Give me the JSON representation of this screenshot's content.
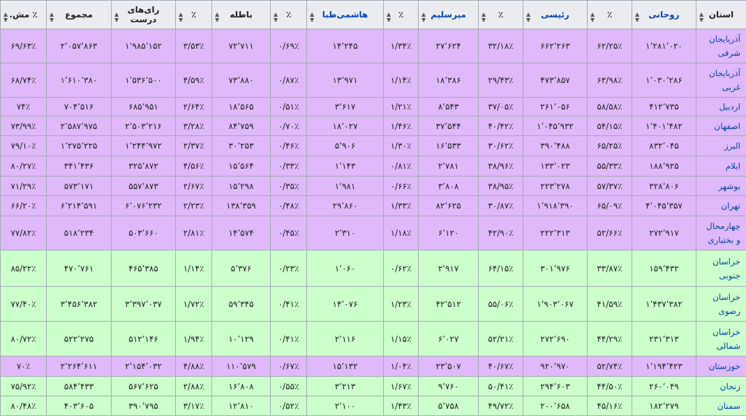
{
  "table": {
    "headers": [
      "استان",
      "روحانی",
      "٪",
      "رئیسی",
      "٪",
      "میرسلیم",
      "٪",
      "هاشمی‌طبا",
      "٪",
      "باطله",
      "٪",
      "رای‌های درست",
      "مجموع",
      "٪ مش."
    ],
    "header_links": [
      false,
      true,
      false,
      true,
      false,
      true,
      false,
      true,
      false,
      false,
      false,
      false,
      false,
      false
    ],
    "colors": {
      "header_bg": "#eaecf0",
      "purple": "#dfb9f9",
      "green": "#ccffcc",
      "link": "#0645ad",
      "border": "#a2a9b1"
    },
    "rows": [
      {
        "group": "purple",
        "cells": [
          "آذربایجان شرقی",
          "۱٬۲۸۱٬۰۲۰",
          "۶۲/۲۵٪",
          "۶۶۲٬۲۶۳",
          "۳۲/۱۸٪",
          "۲۷٬۶۲۴",
          "۱/۳۴٪",
          "۱۴٬۲۴۵",
          "۰/۶۹٪",
          "۷۲٬۷۱۱",
          "۳/۵۳٪",
          "۱٬۹۸۵٬۱۵۲",
          "۲٬۰۵۷٬۸۶۳",
          "۶۹/۶۳٪"
        ]
      },
      {
        "group": "purple",
        "cells": [
          "آذربایجان غربی",
          "۱٬۰۳۰٬۲۸۶",
          "۶۳/۹۸٪",
          "۴۷۳٬۸۵۷",
          "۲۹/۴۳٪",
          "۱۸٬۳۸۶",
          "۱/۱۴٪",
          "۱۳٬۹۷۱",
          "۰/۸۷٪",
          "۷۳٬۸۸۰",
          "۴/۵۹٪",
          "۱٬۵۳۶٬۵۰۰",
          "۱٬۶۱۰٬۳۸۰",
          "۶۸/۷۴٪"
        ]
      },
      {
        "group": "purple",
        "cells": [
          "اردبیل",
          "۴۱۲٬۷۳۵",
          "۵۸/۵۸٪",
          "۲۶۱٬۰۵۶",
          "۳۷/۰۵٪",
          "۸٬۵۴۳",
          "۱/۲۱٪",
          "۳٬۶۱۷",
          "۰/۵۱٪",
          "۱۸٬۵۶۵",
          "۲/۶۴٪",
          "۶۸۵٬۹۵۱",
          "۷۰۴٬۵۱۶",
          "۷۴٪"
        ]
      },
      {
        "group": "purple",
        "cells": [
          "اصفهان",
          "۱٬۴۰۱٬۴۸۲",
          "۵۴/۱۵٪",
          "۱٬۰۴۵٬۹۳۲",
          "۴۰/۴۲٪",
          "۳۷٬۵۴۴",
          "۱/۴۶٪",
          "۱۸٬۰۲۷",
          "۰/۷۰٪",
          "۸۴٬۷۵۹",
          "۳/۲۸٪",
          "۲٬۵۰۳٬۲۱۶",
          "۲٬۵۸۷٬۹۷۵",
          "۷۳/۹۹٪"
        ]
      },
      {
        "group": "purple",
        "cells": [
          "البرز",
          "۸۳۲٬۰۴۵",
          "۶۵/۲۵٪",
          "۳۹۰٬۴۸۸",
          "۳۰/۶۲٪",
          "۱۶٬۵۳۳",
          "۱/۳۰٪",
          "۵٬۹۰۶",
          "۰/۴۶٪",
          "۳۰٬۲۵۳",
          "۲/۳۷٪",
          "۱٬۲۴۴٬۹۷۲",
          "۱٬۲۷۵٬۲۲۵",
          "۷۹/۱۰٪"
        ]
      },
      {
        "group": "purple",
        "cells": [
          "ایلام",
          "۱۸۸٬۹۲۵",
          "۵۵/۳۳٪",
          "۱۳۳٬۰۲۳",
          "۳۸/۹۶٪",
          "۲٬۷۸۱",
          "۰/۸۱٪",
          "۱٬۱۴۳",
          "۰/۳۳٪",
          "۱۵٬۵۶۴",
          "۴/۵۶٪",
          "۳۲۵٬۸۷۲",
          "۳۴۱٬۴۳۶",
          "۸۰/۲۷٪"
        ]
      },
      {
        "group": "purple",
        "cells": [
          "بوشهر",
          "۳۲۸٬۸۰۶",
          "۵۷/۳۷٪",
          "۲۲۳٬۲۷۸",
          "۳۸/۹۵٪",
          "۳٬۸۰۸",
          "۰/۶۶٪",
          "۱٬۹۸۱",
          "۰/۳۵٪",
          "۱۵٬۲۹۸",
          "۲/۶۷٪",
          "۵۵۷٬۸۷۳",
          "۵۷۳٬۱۷۱",
          "۷۱/۲۹٪"
        ]
      },
      {
        "group": "purple",
        "cells": [
          "تهران",
          "۴٬۰۴۵٬۳۵۷",
          "۶۵/۰۹٪",
          "۱٬۹۱۸٬۳۹۰",
          "۳۰/۸۷٪",
          "۸۲٬۶۲۵",
          "۱/۳۳٪",
          "۲۹٬۸۶۰",
          "۰/۴۸٪",
          "۱۳۸٬۳۵۹",
          "۲/۲۳٪",
          "۶٬۰۷۶٬۲۳۲",
          "۶٬۲۱۴٬۵۹۱",
          "۶۶/۲۰٪"
        ]
      },
      {
        "group": "purple",
        "cells": [
          "چهارمحال و بختیاری",
          "۲۷۲٬۹۱۷",
          "۵۲/۶۶٪",
          "۲۲۲٬۳۱۳",
          "۴۲/۹۰٪",
          "۶٬۱۲۰",
          "۱/۱۸٪",
          "۲٬۳۱۰",
          "۰/۴۵٪",
          "۱۴٬۵۷۴",
          "۲/۸۱٪",
          "۵۰۳٬۶۶۰",
          "۵۱۸٬۲۳۴",
          "۷۷/۸۲٪"
        ]
      },
      {
        "group": "green",
        "cells": [
          "خراسان جنوبی",
          "۱۵۹٬۴۳۲",
          "۳۳/۸۷٪",
          "۳۰۱٬۹۷۶",
          "۶۴/۱۵٪",
          "۲٬۹۱۷",
          "۰/۶۲٪",
          "۱٬۰۶۰",
          "۰/۲۳٪",
          "۵٬۳۷۶",
          "۱/۱۴٪",
          "۴۶۵٬۳۸۵",
          "۴۷۰٬۷۶۱",
          "۸۵/۲۲٪"
        ]
      },
      {
        "group": "green",
        "cells": [
          "خراسان رضوی",
          "۱٬۴۳۷٬۳۸۲",
          "۴۱/۵۹٪",
          "۱٬۹۰۳٬۰۶۷",
          "۵۵/۰۶٪",
          "۴۲٬۵۱۲",
          "۱/۲۳٪",
          "۱۴٬۰۷۶",
          "۰/۴۱٪",
          "۵۹٬۳۴۵",
          "۱/۷۲٪",
          "۳٬۳۹۷٬۰۳۷",
          "۳٬۴۵۶٬۳۸۲",
          "۷۷/۴۰٪"
        ]
      },
      {
        "group": "green",
        "cells": [
          "خراسان شمالی",
          "۲۳۱٬۳۱۳",
          "۴۴/۲۹٪",
          "۲۷۲٬۶۹۰",
          "۵۲/۲۱٪",
          "۶٬۰۲۷",
          "۱/۱۵٪",
          "۲٬۱۱۶",
          "۰/۴۱٪",
          "۱۰٬۱۲۹",
          "۱/۹۴٪",
          "۵۱۲٬۱۴۶",
          "۵۲۲٬۲۷۵",
          "۸۰/۷۲٪"
        ]
      },
      {
        "group": "purple",
        "cells": [
          "خوزستان",
          "۱٬۱۹۴٬۴۲۳",
          "۵۲/۷۴٪",
          "۹۲۰٬۹۷۰",
          "۴۰/۶۷٪",
          "۲۳٬۵۰۷",
          "۱/۰۴٪",
          "۱۵٬۱۳۲",
          "۰/۶۷٪",
          "۱۱۰٬۵۷۹",
          "۴/۸۸٪",
          "۲٬۱۵۴٬۰۳۲",
          "۲٬۲۶۴٬۶۱۱",
          "۷۰٪"
        ]
      },
      {
        "group": "green",
        "cells": [
          "زنجان",
          "۲۶۰٬۰۴۹",
          "۴۴/۵۰٪",
          "۲۹۴٬۶۰۳",
          "۵۰/۴۱٪",
          "۹٬۷۶۰",
          "۱/۶۷٪",
          "۳٬۲۱۳",
          "۰/۵۵٪",
          "۱۶٬۸۰۸",
          "۲/۸۸٪",
          "۵۶۷٬۶۲۵",
          "۵۸۴٬۴۳۳",
          "۷۵/۹۲٪"
        ]
      },
      {
        "group": "green",
        "cells": [
          "سمنان",
          "۱۸۲٬۲۷۹",
          "۴۵/۱۶٪",
          "۲۰۰٬۶۵۸",
          "۴۹/۷۲٪",
          "۵٬۷۵۸",
          "۱/۴۳٪",
          "۲٬۱۰۰",
          "۰/۵۲٪",
          "۱۲٬۸۱۰",
          "۳/۱۷٪",
          "۳۹۰٬۷۹۵",
          "۴۰۳٬۶۰۵",
          "۸۰/۴۸٪"
        ]
      }
    ]
  }
}
